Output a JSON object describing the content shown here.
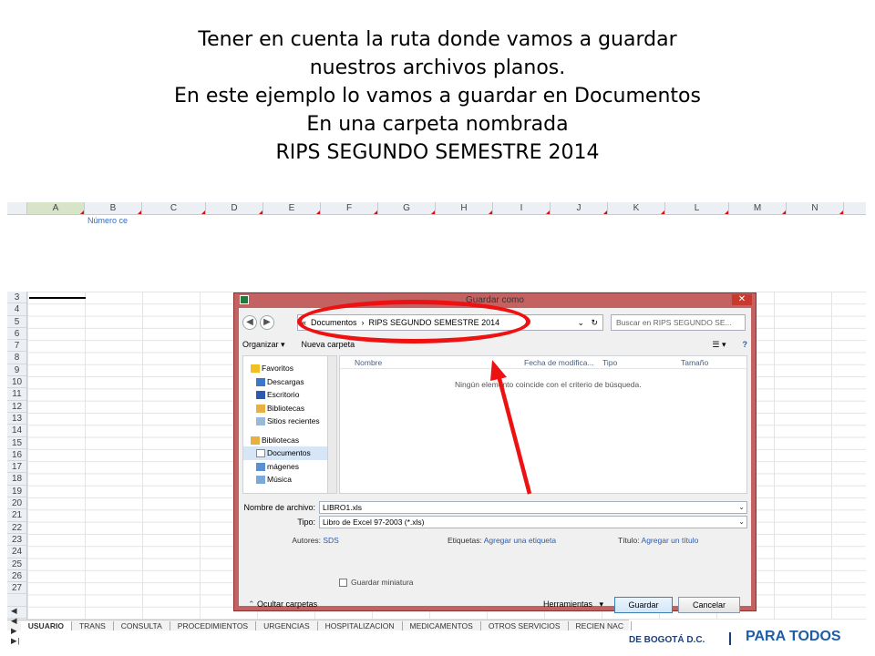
{
  "caption": {
    "line1": "Tener en cuenta la ruta donde vamos a guardar",
    "line2": "nuestros archivos planos.",
    "line3": "En este ejemplo lo vamos a guardar en Documentos",
    "line4": "En una carpeta nombrada",
    "line5": "RIPS SEGUNDO SEMESTRE 2014"
  },
  "sheet": {
    "columns": [
      "A",
      "B",
      "C",
      "D",
      "E",
      "F",
      "G",
      "H",
      "I",
      "J",
      "K",
      "L",
      "M",
      "N"
    ],
    "cell_b2": "Número ce",
    "rows": [
      "3",
      "4",
      "5",
      "6",
      "7",
      "8",
      "9",
      "10",
      "11",
      "12",
      "13",
      "14",
      "15",
      "16",
      "17",
      "18",
      "19",
      "20",
      "21",
      "22",
      "23",
      "24",
      "25",
      "26",
      "27"
    ],
    "tab_nav": "◀ ◀ ▶ ▶|",
    "tabs": [
      "USUARIO",
      "TRANS",
      "CONSULTA",
      "PROCEDIMIENTOS",
      "URGENCIAS",
      "HOSPITALIZACION",
      "MEDICAMENTOS",
      "OTROS SERVICIOS",
      "RECIEN NAC"
    ]
  },
  "dialog": {
    "title": "Guardar como",
    "close": "✕",
    "back": "◀",
    "forward": "▶",
    "path_prefix": "«",
    "path1": "Documentos",
    "path_sep": "›",
    "path2": "RIPS SEGUNDO SEMESTRE 2014",
    "path_dd": "⌄",
    "refresh": "↻",
    "search_placeholder": "Buscar en RIPS SEGUNDO SE...",
    "organize": "Organizar ▾",
    "new_folder": "Nueva carpeta",
    "view": "☰ ▾",
    "help": "?",
    "nav": {
      "favorites": "Favoritos",
      "downloads": "Descargas",
      "desktop": "Escritorio",
      "libraries_fav": "Bibliotecas",
      "recent": "Sitios recientes",
      "libraries": "Bibliotecas",
      "documents": "Documentos",
      "images": "mágenes",
      "music": "Música"
    },
    "columns": {
      "name": "Nombre",
      "date": "Fecha de modifica...",
      "type": "Tipo",
      "size": "Tamaño"
    },
    "empty_message": "Ningún elemento coincide con el criterio de búsqueda.",
    "filename_label": "Nombre de archivo:",
    "filename_value": "LIBRO1.xls",
    "type_label": "Tipo:",
    "type_value": "Libro de Excel 97-2003 (*.xls)",
    "authors_label": "Autores:",
    "authors_value": "SDS",
    "tags_label": "Etiquetas:",
    "tags_value": "Agregar una etiqueta",
    "title_label": "Título:",
    "title_value": "Agregar un título",
    "thumbnail_label": "Guardar miniatura",
    "hide_folders": "Ocultar carpetas",
    "tools": "Herramientas",
    "tools_dd": "▾",
    "save": "Guardar",
    "cancel": "Cancelar"
  },
  "logo": {
    "line1": "DE BOGOTÁ D.C.",
    "tagline": "PARA TODOS"
  },
  "colors": {
    "highlight": "#ee1111",
    "dialog_frame": "#c46262",
    "link": "#2a5bb0"
  }
}
